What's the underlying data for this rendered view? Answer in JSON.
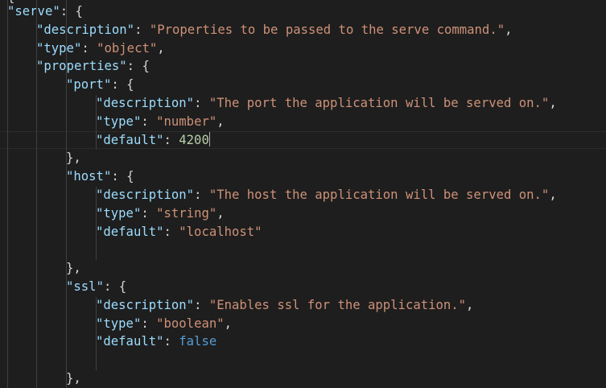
{
  "lines": [
    [
      {
        "c": "t-key",
        "t": "\"serve\""
      },
      {
        "c": "t-punc",
        "t": ": {"
      }
    ],
    [
      {
        "c": "t-key",
        "t": "\"description\""
      },
      {
        "c": "t-punc",
        "t": ": "
      },
      {
        "c": "t-str",
        "t": "\"Properties to be passed to the serve command.\""
      },
      {
        "c": "t-punc",
        "t": ","
      }
    ],
    [
      {
        "c": "t-key",
        "t": "\"type\""
      },
      {
        "c": "t-punc",
        "t": ": "
      },
      {
        "c": "t-str",
        "t": "\"object\""
      },
      {
        "c": "t-punc",
        "t": ","
      }
    ],
    [
      {
        "c": "t-key",
        "t": "\"properties\""
      },
      {
        "c": "t-punc",
        "t": ": {"
      }
    ],
    [
      {
        "c": "t-key",
        "t": "\"port\""
      },
      {
        "c": "t-punc",
        "t": ": {"
      }
    ],
    [
      {
        "c": "t-key",
        "t": "\"description\""
      },
      {
        "c": "t-punc",
        "t": ": "
      },
      {
        "c": "t-str",
        "t": "\"The port the application will be served on.\""
      },
      {
        "c": "t-punc",
        "t": ","
      }
    ],
    [
      {
        "c": "t-key",
        "t": "\"type\""
      },
      {
        "c": "t-punc",
        "t": ": "
      },
      {
        "c": "t-str",
        "t": "\"number\""
      },
      {
        "c": "t-punc",
        "t": ","
      }
    ],
    [
      {
        "c": "t-key",
        "t": "\"default\""
      },
      {
        "c": "t-punc",
        "t": ": "
      },
      {
        "c": "t-num",
        "t": "4200"
      }
    ],
    [
      {
        "c": "t-punc",
        "t": "},"
      }
    ],
    [
      {
        "c": "t-key",
        "t": "\"host\""
      },
      {
        "c": "t-punc",
        "t": ": {"
      }
    ],
    [
      {
        "c": "t-key",
        "t": "\"description\""
      },
      {
        "c": "t-punc",
        "t": ": "
      },
      {
        "c": "t-str",
        "t": "\"The host the application will be served on.\""
      },
      {
        "c": "t-punc",
        "t": ","
      }
    ],
    [
      {
        "c": "t-key",
        "t": "\"type\""
      },
      {
        "c": "t-punc",
        "t": ": "
      },
      {
        "c": "t-str",
        "t": "\"string\""
      },
      {
        "c": "t-punc",
        "t": ","
      }
    ],
    [
      {
        "c": "t-key",
        "t": "\"default\""
      },
      {
        "c": "t-punc",
        "t": ": "
      },
      {
        "c": "t-str",
        "t": "\"localhost\""
      }
    ],
    [],
    [
      {
        "c": "t-punc",
        "t": "},"
      }
    ],
    [
      {
        "c": "t-key",
        "t": "\"ssl\""
      },
      {
        "c": "t-punc",
        "t": ": {"
      }
    ],
    [
      {
        "c": "t-key",
        "t": "\"description\""
      },
      {
        "c": "t-punc",
        "t": ": "
      },
      {
        "c": "t-str",
        "t": "\"Enables ssl for the application.\""
      },
      {
        "c": "t-punc",
        "t": ","
      }
    ],
    [
      {
        "c": "t-key",
        "t": "\"type\""
      },
      {
        "c": "t-punc",
        "t": ": "
      },
      {
        "c": "t-str",
        "t": "\"boolean\""
      },
      {
        "c": "t-punc",
        "t": ","
      }
    ],
    [
      {
        "c": "t-key",
        "t": "\"default\""
      },
      {
        "c": "t-punc",
        "t": ": "
      },
      {
        "c": "t-kw",
        "t": "false"
      }
    ],
    [],
    [
      {
        "c": "t-punc",
        "t": "},"
      }
    ]
  ],
  "colors": {
    "background": "#1e1e1e",
    "key": "#9cdcfe",
    "string": "#ce9178",
    "number": "#b5cea8",
    "keyword": "#569cd6",
    "punctuation": "#d4d4d4",
    "indent_guide": "#404040"
  }
}
